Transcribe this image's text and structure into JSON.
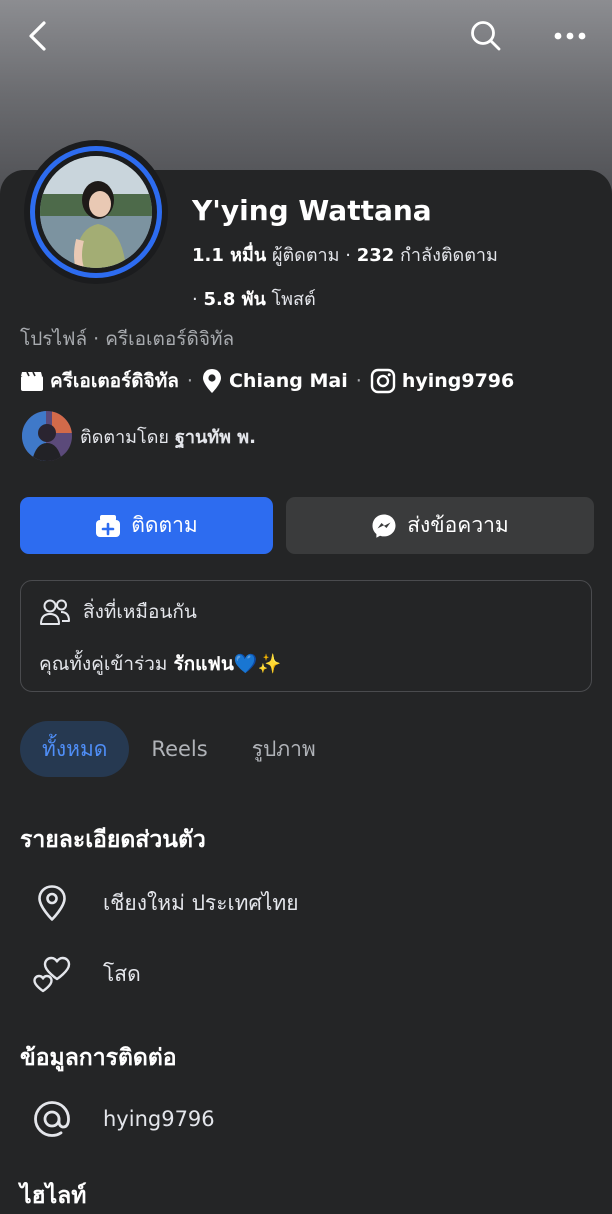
{
  "colors": {
    "accent": "#2d6cf0",
    "background": "#242526",
    "button_secondary": "#3a3b3c",
    "tab_active_bg": "#263951",
    "tab_active_text": "#4f8ef7"
  },
  "topbar": {
    "back_icon": "chevron-left-icon",
    "search_icon": "search-icon",
    "more_icon": "more-horizontal-icon"
  },
  "profile": {
    "name": "Y'ying Wattana",
    "followers_count": "1.1 หมื่น",
    "followers_label": "ผู้ติดตาม",
    "following_count": "232",
    "following_label": "กำลังติดตาม",
    "posts_count": "5.8 พัน",
    "posts_label": "โพสต์",
    "subtitle": "โปรไฟล์ · ครีเอเตอร์ดิจิทัล",
    "category": "ครีเอเตอร์ดิจิทัล",
    "city": "Chiang Mai",
    "instagram": "hying9796",
    "followed_by_prefix": "ติดตามโดย",
    "followed_by_name": "ฐานทัพ พ."
  },
  "actions": {
    "follow_label": "ติดตาม",
    "message_label": "ส่งข้อความ"
  },
  "mutual": {
    "title": "สิ่งที่เหมือนกัน",
    "body_prefix": "คุณทั้งคู่เข้าร่วม",
    "group_name": "รักแฟน💙✨"
  },
  "tabs": [
    {
      "label": "ทั้งหมด",
      "active": true
    },
    {
      "label": "Reels",
      "active": false
    },
    {
      "label": "รูปภาพ",
      "active": false
    }
  ],
  "details": {
    "title": "รายละเอียดส่วนตัว",
    "location": "เชียงใหม่ ประเทศไทย",
    "relationship": "โสด"
  },
  "contact": {
    "title": "ข้อมูลการติดต่อ",
    "instagram": "hying9796"
  },
  "highlights": {
    "title": "ไฮไลท์"
  }
}
